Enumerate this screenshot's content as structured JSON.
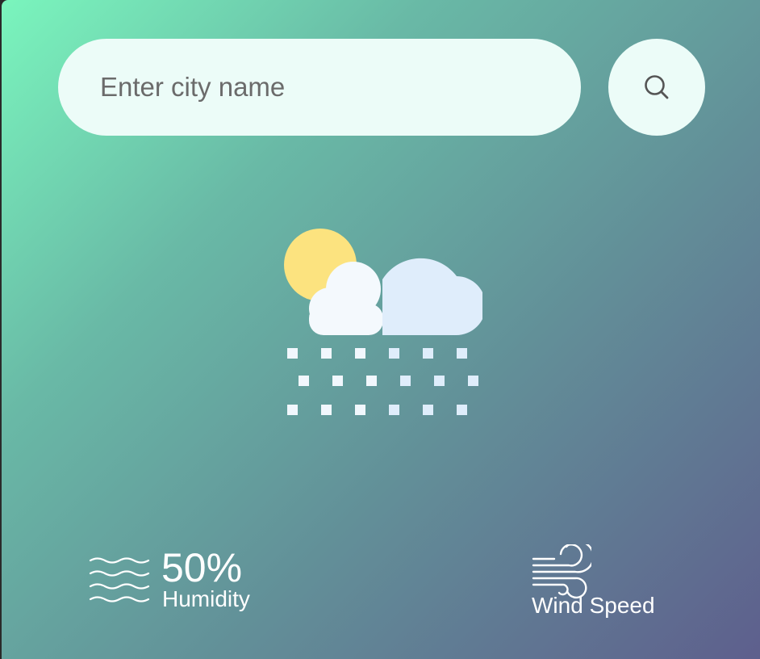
{
  "search": {
    "placeholder": "Enter city name",
    "value": "",
    "button_icon": "search-icon"
  },
  "weather": {
    "icon": "sun-cloud-snow-icon",
    "colors": {
      "sun": "#fce37f",
      "cloud_left": "#f4f9fd",
      "cloud_right": "#dfedfb",
      "flakes": "#f1f7fd"
    }
  },
  "humidity": {
    "icon": "humidity-waves-icon",
    "value": "50%",
    "label": "Humidity"
  },
  "wind": {
    "icon": "wind-icon",
    "value": "",
    "label": "Wind Speed"
  },
  "theme": {
    "gradient_start": "#7af5bd",
    "gradient_end": "#5e5f8d",
    "input_bg": "#ecfcf8",
    "text": "#ffffff"
  }
}
